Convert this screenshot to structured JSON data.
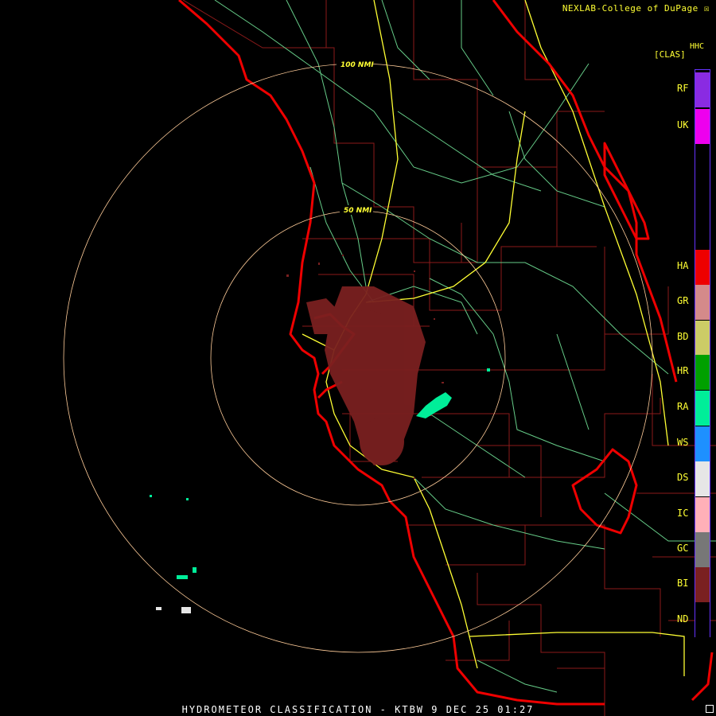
{
  "credit": "NEXLAB-College of DuPage ☒",
  "legend": {
    "code": "HHC",
    "unit": "[CLAS]",
    "classes": [
      {
        "code": "RF",
        "color": "#8a2be2"
      },
      {
        "code": "UK",
        "color": "#ee00ee"
      },
      {
        "code": "HA",
        "color": "#ee0000"
      },
      {
        "code": "GR",
        "color": "#d48a8a"
      },
      {
        "code": "BD",
        "color": "#cccc66"
      },
      {
        "code": "HR",
        "color": "#00a000"
      },
      {
        "code": "RA",
        "color": "#00ee99"
      },
      {
        "code": "WS",
        "color": "#1e90ff"
      },
      {
        "code": "DS",
        "color": "#e6e6e6"
      },
      {
        "code": "IC",
        "color": "#ffb0b8"
      },
      {
        "code": "GC",
        "color": "#777777"
      },
      {
        "code": "BI",
        "color": "#7a2020"
      },
      {
        "code": "ND",
        "color": "#000000"
      }
    ]
  },
  "range_rings": {
    "inner": "50 NMI",
    "outer": "100 NMI"
  },
  "footer": "HYDROMETEOR CLASSIFICATION - KTBW 9 DEC 25 01:27",
  "colors": {
    "coast": "#ee0000",
    "county": "#8b1a1a",
    "highway": "#ffff33",
    "road": "#66cc88",
    "ring": "#ffcc99",
    "bio": "#7a2020",
    "rain": "#00ee99"
  }
}
